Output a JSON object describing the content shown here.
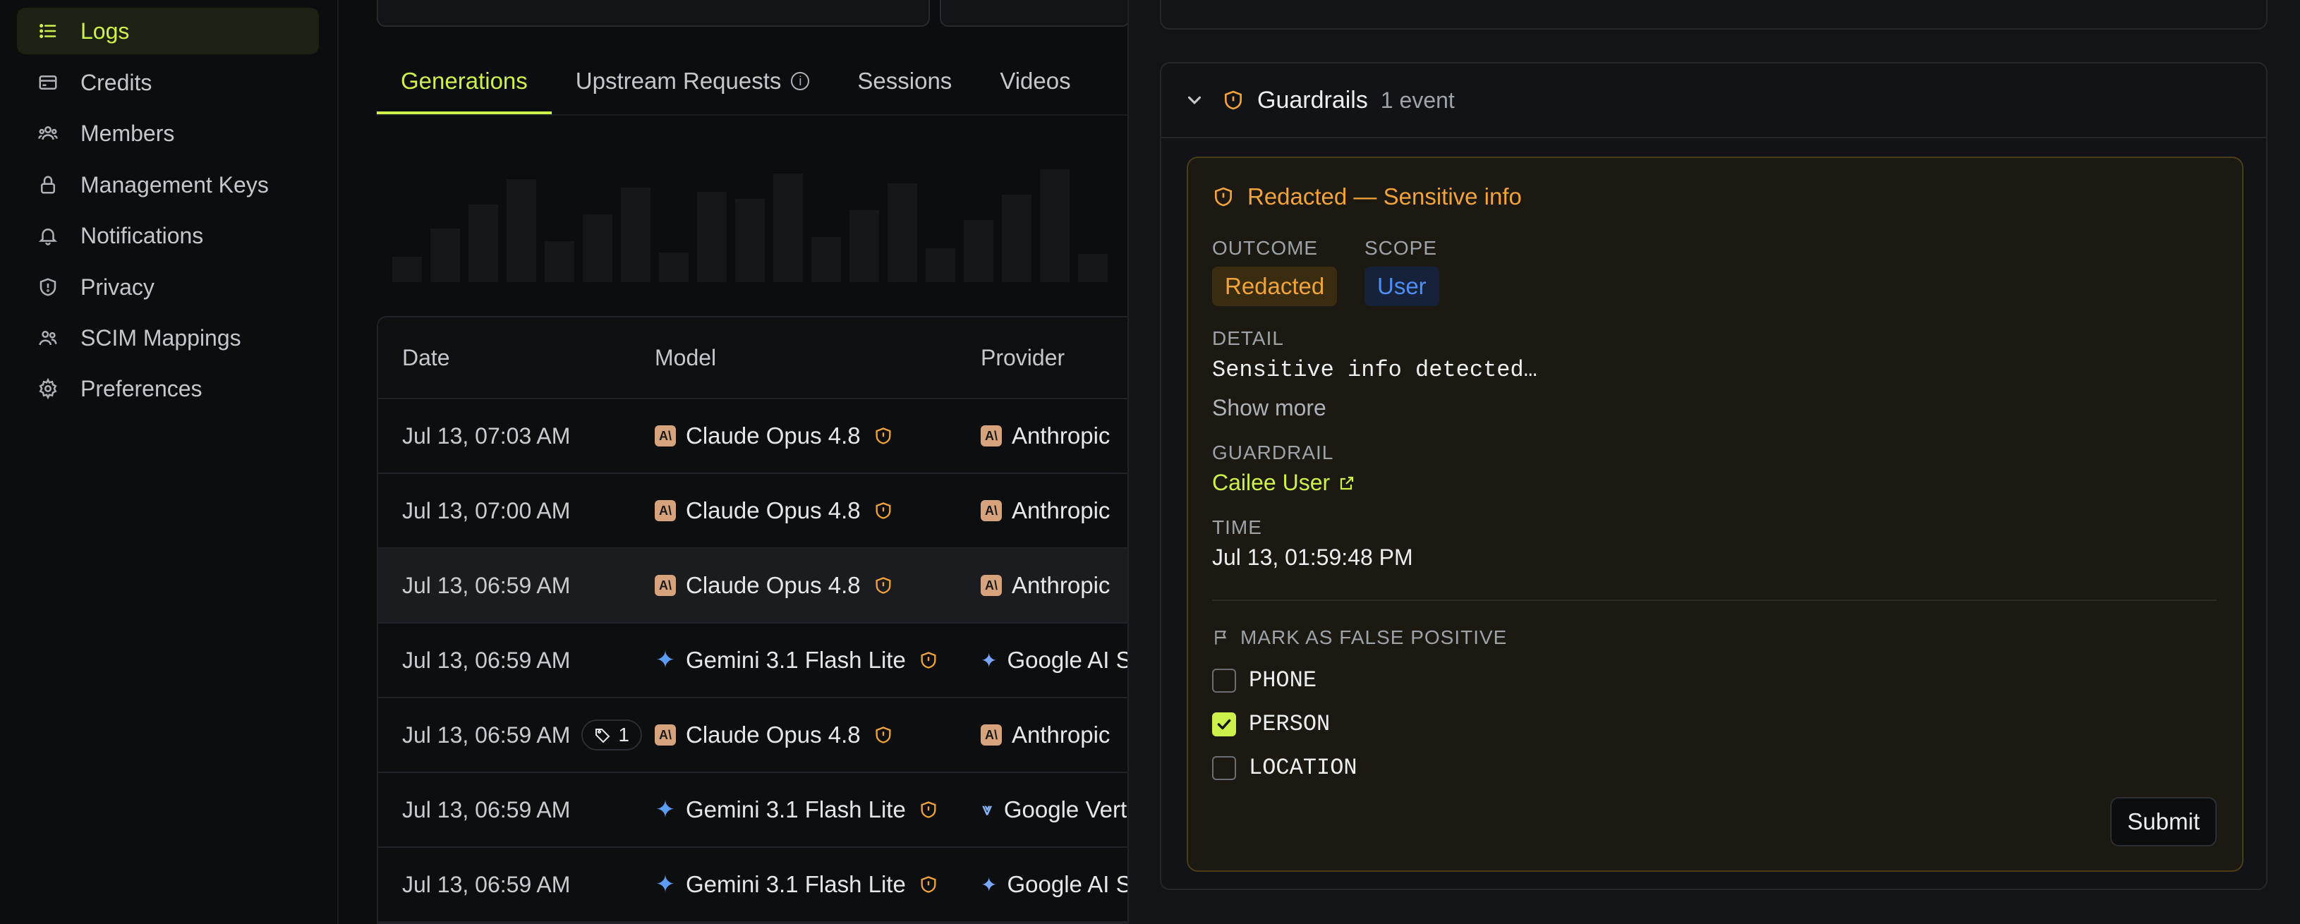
{
  "sidebar": {
    "items": [
      {
        "label": "Logs",
        "icon": "list-icon",
        "active": true
      },
      {
        "label": "Credits",
        "icon": "credit-card-icon"
      },
      {
        "label": "Members",
        "icon": "users-icon"
      },
      {
        "label": "Management Keys",
        "icon": "lock-icon"
      },
      {
        "label": "Notifications",
        "icon": "bell-icon"
      },
      {
        "label": "Privacy",
        "icon": "shield-icon"
      },
      {
        "label": "SCIM Mappings",
        "icon": "user-group-icon"
      },
      {
        "label": "Preferences",
        "icon": "gear-icon"
      }
    ]
  },
  "tabs": [
    {
      "label": "Generations",
      "active": true
    },
    {
      "label": "Upstream Requests",
      "has_info": true
    },
    {
      "label": "Sessions"
    },
    {
      "label": "Videos"
    }
  ],
  "table": {
    "headers": {
      "date": "Date",
      "model": "Model",
      "provider": "Provider"
    },
    "rows": [
      {
        "date": "Jul 13, 07:03 AM",
        "model": "Claude Opus 4.8",
        "model_icon": "anthropic-icon",
        "provider": "Anthropic",
        "provider_icon": "anthropic-icon"
      },
      {
        "date": "Jul 13, 07:00 AM",
        "model": "Claude Opus 4.8",
        "model_icon": "anthropic-icon",
        "provider": "Anthropic",
        "provider_icon": "anthropic-icon"
      },
      {
        "date": "Jul 13, 06:59 AM",
        "model": "Claude Opus 4.8",
        "model_icon": "anthropic-icon",
        "provider": "Anthropic",
        "provider_icon": "anthropic-icon",
        "selected": true
      },
      {
        "date": "Jul 13, 06:59 AM",
        "model": "Gemini 3.1 Flash Lite",
        "model_icon": "gemini-icon",
        "provider": "Google AI Studio",
        "provider_icon": "google-ai-studio-icon"
      },
      {
        "date": "Jul 13, 06:59 AM",
        "pill": "1",
        "model": "Claude Opus 4.8",
        "model_icon": "anthropic-icon",
        "provider": "Anthropic",
        "provider_icon": "anthropic-icon"
      },
      {
        "date": "Jul 13, 06:59 AM",
        "model": "Gemini 3.1 Flash Lite",
        "model_icon": "gemini-icon",
        "provider": "Google Vertex",
        "provider_icon": "google-vertex-icon"
      },
      {
        "date": "Jul 13, 06:59 AM",
        "model": "Gemini 3.1 Flash Lite",
        "model_icon": "gemini-icon",
        "provider": "Google AI Studio",
        "provider_icon": "google-ai-studio-icon"
      }
    ]
  },
  "panel": {
    "guardrails": {
      "title": "Guardrails",
      "count": "1 event",
      "event": {
        "title": "Redacted — Sensitive info",
        "outcome_label": "OUTCOME",
        "outcome": "Redacted",
        "scope_label": "SCOPE",
        "scope": "User",
        "detail_label": "DETAIL",
        "detail": "Sensitive info detected…",
        "show_more": "Show more",
        "guardrail_label": "GUARDRAIL",
        "guardrail": "Cailee User",
        "time_label": "TIME",
        "time": "Jul 13, 01:59:48 PM",
        "fp_label": "MARK AS FALSE POSITIVE",
        "options": [
          {
            "label": "PHONE",
            "checked": false
          },
          {
            "label": "PERSON",
            "checked": true
          },
          {
            "label": "LOCATION",
            "checked": false
          }
        ],
        "submit": "Submit"
      }
    }
  },
  "colors": {
    "accent": "#cdf14a",
    "warning": "#f2a33a",
    "scope_blue": "#4d8ef7",
    "background": "#0b0d0f"
  }
}
